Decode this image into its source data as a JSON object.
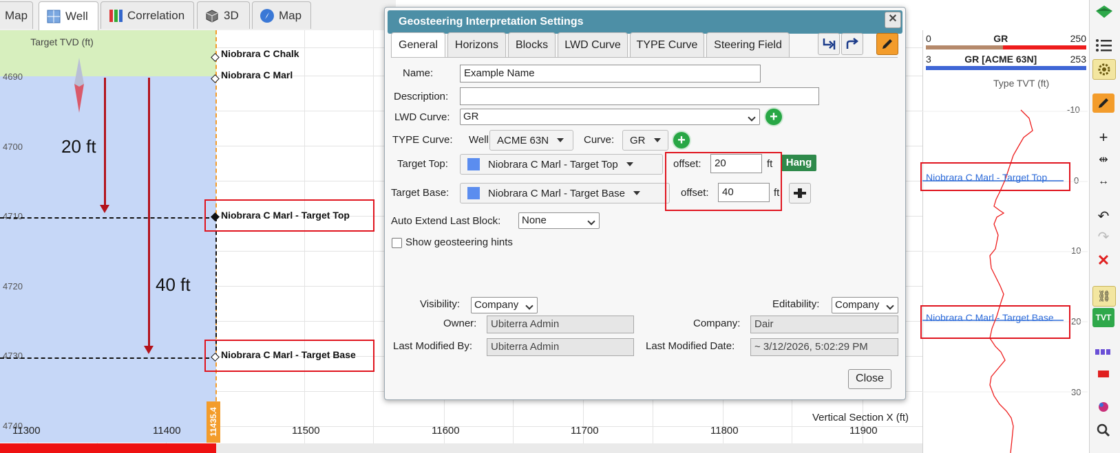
{
  "top_tabs": [
    {
      "label": "Map",
      "icon": "map-icon"
    },
    {
      "label": "Well",
      "icon": "well-icon"
    },
    {
      "label": "Correlation",
      "icon": "correlation-icon"
    },
    {
      "label": "3D",
      "icon": "cube-icon"
    },
    {
      "label": "Map",
      "icon": "compass-icon"
    }
  ],
  "well_view": {
    "target_tvd_label": "Target TVD (ft)",
    "depth_ticks": [
      "4690",
      "4700",
      "4710",
      "4720",
      "4730",
      "4740"
    ],
    "horizons": {
      "chalk": "Niobrara C Chalk",
      "marl": "Niobrara C Marl",
      "target_top": "Niobrara C Marl - Target Top",
      "target_base": "Niobrara C Marl - Target Base"
    },
    "annotation_20": "20 ft",
    "annotation_40": "40 ft",
    "x_axis_title": "Vertical Section X (ft)",
    "x_ticks": [
      "11300",
      "11400",
      "11500",
      "11600",
      "11700",
      "11800",
      "11900"
    ],
    "position_badge": "11435.4"
  },
  "dialog": {
    "title": "Geosteering Interpretation Settings",
    "tabs": [
      "General",
      "Horizons",
      "Blocks",
      "LWD Curve",
      "TYPE Curve",
      "Steering Field"
    ],
    "name_label": "Name:",
    "name_value": "Example Name",
    "description_label": "Description:",
    "description_value": "",
    "lwd_label": "LWD Curve:",
    "lwd_value": "GR",
    "type_curve_label": "TYPE Curve:",
    "well_label": "Well:",
    "well_value": "ACME 63N",
    "curve_label": "Curve:",
    "curve_value": "GR",
    "target_top_label": "Target Top:",
    "target_top_value": "Niobrara C Marl - Target Top",
    "target_base_label": "Target Base:",
    "target_base_value": "Niobrara C Marl - Target Base",
    "offset_label": "offset:",
    "top_offset": "20",
    "base_offset": "40",
    "unit": "ft",
    "hang_label": "Hang",
    "auto_extend_label": "Auto Extend Last Block:",
    "auto_extend_value": "None",
    "show_hints_label": "Show geosteering hints",
    "show_hints_checked": false,
    "visibility_label": "Visibility:",
    "visibility_value": "Company",
    "editability_label": "Editability:",
    "editability_value": "Company",
    "owner_label": "Owner:",
    "owner_value": "Ubiterra Admin",
    "company_label": "Company:",
    "company_value": "Dair",
    "last_modified_by_label": "Last Modified By:",
    "last_modified_by_value": "Ubiterra Admin",
    "last_modified_date_label": "Last Modified Date:",
    "last_modified_date_value": "~ 3/12/2026, 5:02:29 PM",
    "close_label": "Close"
  },
  "track": {
    "gr_min": "0",
    "gr_label": "GR",
    "gr_max": "250",
    "gr2_min": "3",
    "gr2_label": "GR [ACME 63N]",
    "gr2_max": "253",
    "tvt_title": "Type TVT (ft)",
    "tvt_ticks": [
      "-10",
      "0",
      "10",
      "20",
      "30"
    ],
    "target_top": "Niobrara C Marl - Target Top",
    "target_base": "Niobrara C Marl - Target Base"
  },
  "colors": {
    "accent_title": "#4d8fa6",
    "highlight_red": "#e0141e",
    "target_blue": "#c6d7f7",
    "hang_green": "#2f8a4b",
    "orange": "#f39c2b"
  }
}
